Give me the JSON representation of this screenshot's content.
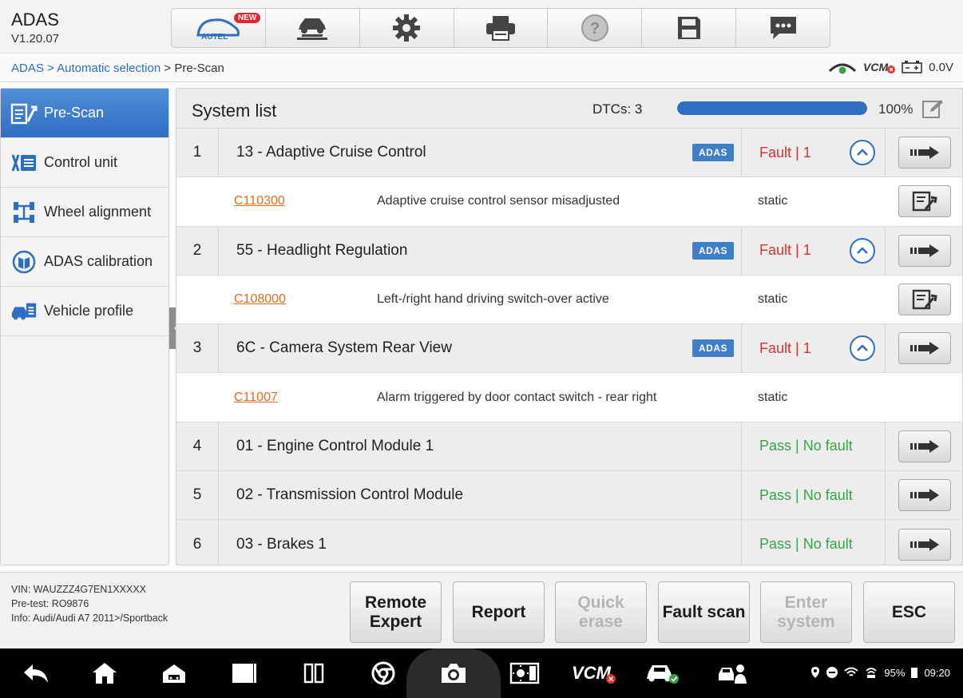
{
  "app": {
    "title": "ADAS",
    "version": "V1.20.07"
  },
  "toolbar": {
    "new_badge": "NEW",
    "autel_label": "AUTEL",
    "buttons": [
      {
        "icon": "autel-home-icon"
      },
      {
        "icon": "vehicle-lift-icon"
      },
      {
        "icon": "settings-gear-icon"
      },
      {
        "icon": "printer-icon"
      },
      {
        "icon": "help-icon"
      },
      {
        "icon": "save-icon"
      },
      {
        "icon": "message-icon"
      }
    ]
  },
  "breadcrumb": {
    "part1": "ADAS",
    "sep1": " > ",
    "part2": "Automatic selection",
    "sep2": " > ",
    "part3": "Pre-Scan"
  },
  "status": {
    "vcm": "VCM",
    "voltage": "0.0V"
  },
  "sidebar": {
    "items": [
      {
        "label": "Pre-Scan",
        "active": true
      },
      {
        "label": "Control unit"
      },
      {
        "label": "Wheel alignment"
      },
      {
        "label": "ADAS calibration"
      },
      {
        "label": "Vehicle profile"
      }
    ]
  },
  "system_list": {
    "title": "System list",
    "dtcs": "DTCs: 3",
    "progress": 100,
    "progress_text": "100%",
    "systems": [
      {
        "num": "1",
        "name": "13 - Adaptive Cruise Control",
        "adas": "ADAS",
        "status": "Fault | 1",
        "dtc": {
          "code": "C110300",
          "desc": "Adaptive cruise control sensor  misadjusted",
          "state": "static"
        }
      },
      {
        "num": "2",
        "name": "55 - Headlight Regulation",
        "adas": "ADAS",
        "status": "Fault | 1",
        "dtc": {
          "code": "C108000",
          "desc": "Left-/right hand driving switch-over active",
          "state": "static"
        }
      },
      {
        "num": "3",
        "name": "6C - Camera System Rear View",
        "adas": "ADAS",
        "status": "Fault | 1",
        "dtc": {
          "code": "C11007",
          "desc": "Alarm triggered by door contact switch - rear right",
          "state": "static"
        }
      },
      {
        "num": "4",
        "name": "01 - Engine Control Module 1",
        "status": "Pass | No fault"
      },
      {
        "num": "5",
        "name": "02 - Transmission Control Module",
        "status": "Pass | No fault"
      },
      {
        "num": "6",
        "name": "03 - Brakes 1",
        "status": "Pass | No fault"
      }
    ]
  },
  "vehicle": {
    "vin": "VIN: WAUZZZ4G7EN1XXXXX",
    "pretest": "Pre-test: RO9876",
    "info": "Info: Audi/Audi A7 2011>/Sportback"
  },
  "footer_buttons": {
    "remote_expert_1": "Remote",
    "remote_expert_2": "Expert",
    "report": "Report",
    "quick_erase_1": "Quick",
    "quick_erase_2": "erase",
    "fault_scan": "Fault scan",
    "enter_system_1": "Enter",
    "enter_system_2": "system",
    "esc": "ESC"
  },
  "android": {
    "battery": "95%",
    "time": "09:20",
    "vcm": "VCM"
  },
  "colors": {
    "accent": "#2f6ec2",
    "fault": "#e03131",
    "pass": "#3aa14a",
    "dtc_code": "#e06d22"
  }
}
